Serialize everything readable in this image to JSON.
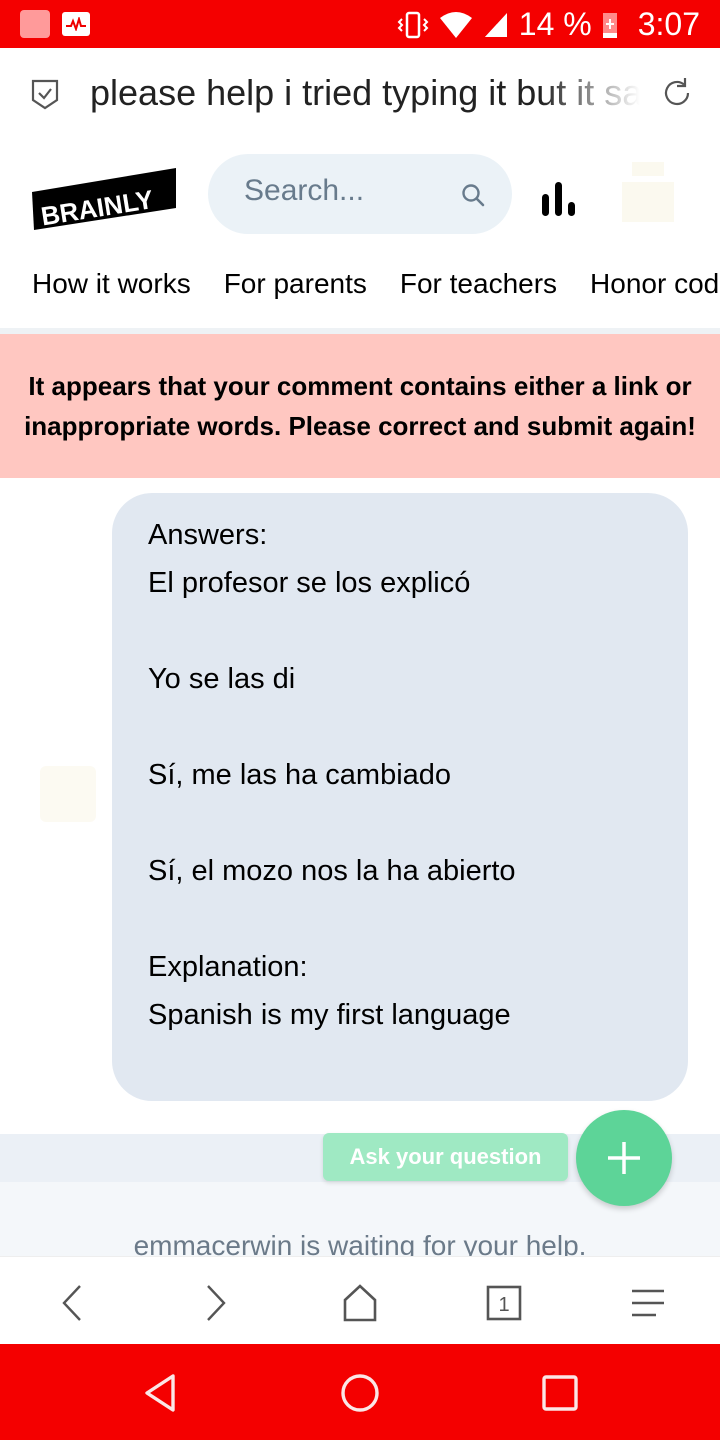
{
  "status_bar": {
    "battery_percent": "14 %",
    "time": "3:07",
    "icons": [
      "notification-app-icon",
      "activity-app-icon",
      "vibrate-icon",
      "wifi-icon",
      "cell-signal-icon",
      "battery-charging-icon"
    ]
  },
  "url_bar": {
    "shield_icon": "shield-check-icon",
    "text": "please help i tried typing it but it says",
    "reload_icon": "reload-icon"
  },
  "header": {
    "logo_text": "BRAINLY",
    "search_placeholder": "Search...",
    "search_icon": "search-icon",
    "stats_icon": "bar-chart-icon"
  },
  "nav": {
    "items": [
      {
        "label": "How it works"
      },
      {
        "label": "For parents"
      },
      {
        "label": "For teachers"
      },
      {
        "label": "Honor code"
      }
    ]
  },
  "alert": {
    "message": "It appears that your comment contains either a link or inappropriate words. Please correct and submit again!",
    "background": "#ffc7c1"
  },
  "answer": {
    "lines": [
      "Answers:",
      "El profesor se los explicó",
      "",
      "Yo se las di",
      "",
      "Sí, me las ha cambiado",
      "",
      "Sí, el mozo nos la ha abierto",
      "",
      "Explanation:",
      "Spanish is my first language"
    ]
  },
  "actions": {
    "ask_label": "Ask your question",
    "fab_icon": "plus-icon",
    "accent": "#5dd498"
  },
  "footer": {
    "waiting_text": "emmacerwin is waiting for your help."
  },
  "browser_nav": {
    "tab_count": "1",
    "icons": [
      "back-icon",
      "forward-icon",
      "home-icon",
      "tabs-icon",
      "menu-icon"
    ]
  },
  "system_nav": {
    "icons": [
      "back-triangle-icon",
      "home-circle-icon",
      "recents-square-icon"
    ]
  }
}
